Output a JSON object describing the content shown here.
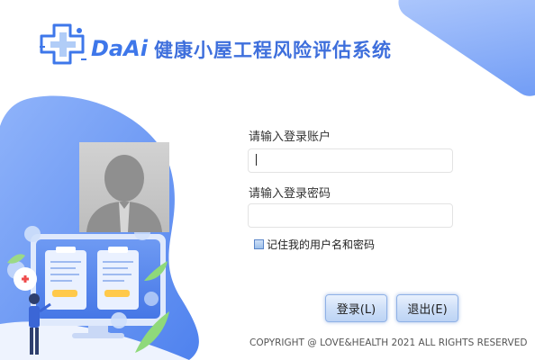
{
  "header": {
    "brand": "DaAi",
    "title": "健康小屋工程风险评估系统"
  },
  "login": {
    "account_label": "请输入登录账户",
    "account_value": "",
    "password_label": "请输入登录密码",
    "password_value": "",
    "remember_label": "记住我的用户名和密码",
    "remember_checked": false,
    "login_button": "登录(L)",
    "exit_button": "退出(E)"
  },
  "footer": {
    "copyright": "COPYRIGHT @ LOVE&HEALTH 2021 ALL RIGHTS RESERVED"
  },
  "icons": [
    "logo-cross-icon",
    "avatar-person-icon",
    "medical-cross-icon"
  ],
  "colors": {
    "brand_blue": "#3e77ea",
    "title_blue": "#3e6fdc",
    "illustration_blue": "#5b8ff0"
  }
}
